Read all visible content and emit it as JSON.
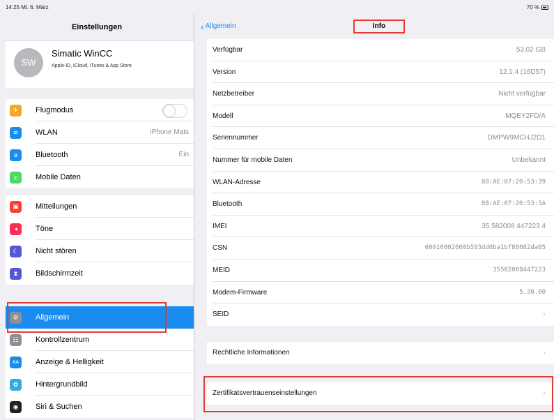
{
  "statusbar": {
    "time": "14:25  Mi. 6. März",
    "battery": "70 %"
  },
  "sidebar": {
    "title": "Einstellungen",
    "profile": {
      "initials": "SW",
      "name": "Simatic WinCC",
      "subtitle": "Apple-ID, iCloud, iTunes & App Store"
    },
    "groups": [
      [
        {
          "label": "Flugmodus",
          "icon": "airplane-icon",
          "color": "#f5a623",
          "glyph": "✈",
          "toggle": true
        },
        {
          "label": "WLAN",
          "icon": "wifi-icon",
          "color": "#1a8cf0",
          "glyph": "≋",
          "value": "iPhone Mats"
        },
        {
          "label": "Bluetooth",
          "icon": "bluetooth-icon",
          "color": "#1a8cf0",
          "glyph": "ʙ",
          "value": "Ein"
        },
        {
          "label": "Mobile Daten",
          "icon": "antenna-icon",
          "color": "#4cd964",
          "glyph": "⍦"
        }
      ],
      [
        {
          "label": "Mitteilungen",
          "icon": "notifications-icon",
          "color": "#ff3b30",
          "glyph": "▣"
        },
        {
          "label": "Töne",
          "icon": "speaker-icon",
          "color": "#ff2d55",
          "glyph": "◂"
        },
        {
          "label": "Nicht stören",
          "icon": "moon-icon",
          "color": "#5856d6",
          "glyph": "☾"
        },
        {
          "label": "Bildschirmzeit",
          "icon": "hourglass-icon",
          "color": "#5856d6",
          "glyph": "⧗"
        }
      ],
      [
        {
          "label": "Allgemein",
          "icon": "gear-icon",
          "color": "#8e8e93",
          "glyph": "⚙",
          "selected": true
        },
        {
          "label": "Kontrollzentrum",
          "icon": "control-center-icon",
          "color": "#8e8e93",
          "glyph": "☷"
        },
        {
          "label": "Anzeige & Helligkeit",
          "icon": "display-icon",
          "color": "#1a8cf0",
          "glyph": "AA"
        },
        {
          "label": "Hintergrundbild",
          "icon": "wallpaper-icon",
          "color": "#34aadc",
          "glyph": "✿"
        },
        {
          "label": "Siri & Suchen",
          "icon": "siri-icon",
          "color": "#222",
          "glyph": "◉"
        }
      ]
    ]
  },
  "detail": {
    "back_label": "Allgemein",
    "title": "Info",
    "rows": [
      {
        "label": "Verfügbar",
        "value": "53,02 GB"
      },
      {
        "label": "Version",
        "value": "12.1.4 (16D57)"
      },
      {
        "label": "Netzbetreiber",
        "value": "Nicht verfügbar"
      },
      {
        "label": "Modell",
        "value": "MQEY2FD/A"
      },
      {
        "label": "Seriennummer",
        "value": "DMPW9MCHJ2D1"
      },
      {
        "label": "Nummer für mobile Daten",
        "value": "Unbekannt"
      },
      {
        "label": "WLAN-Adresse",
        "value": "88:AE:07:20:53:39",
        "mono": true
      },
      {
        "label": "Bluetooth",
        "value": "88:AE:07:20:53:3A",
        "mono": true
      },
      {
        "label": "IMEI",
        "value": "35 582008 447223 4"
      },
      {
        "label": "CSN",
        "value": "60010002000b593dd0ba1bf88082da05",
        "mono": true
      },
      {
        "label": "MEID",
        "value": "35582008447223",
        "mono": true
      },
      {
        "label": "Modem-Firmware",
        "value": "5.30.00",
        "mono": true
      },
      {
        "label": "SEID",
        "arrow": true
      }
    ],
    "legal_label": "Rechtliche Informationen",
    "trust_label": "Zertifikatsvertrauenseinstellungen"
  }
}
